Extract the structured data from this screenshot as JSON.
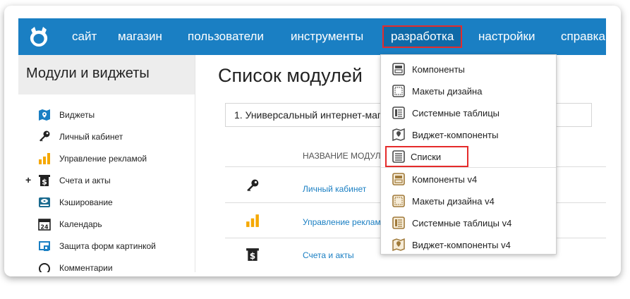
{
  "nav": {
    "items": [
      {
        "label": "сайт"
      },
      {
        "label": "магазин"
      },
      {
        "label": "пользователи"
      },
      {
        "label": "инструменты"
      },
      {
        "label": "разработка"
      },
      {
        "label": "настройки"
      },
      {
        "label": "справка"
      }
    ]
  },
  "sidebar": {
    "title": "Модули и виджеты",
    "items": [
      {
        "label": "Виджеты",
        "icon": "widget-map-icon"
      },
      {
        "label": "Личный кабинет",
        "icon": "key-icon"
      },
      {
        "label": "Управление рекламой",
        "icon": "bar-chart-icon"
      },
      {
        "label": "Счета и акты",
        "icon": "dollar-receipt-icon",
        "expand": "+"
      },
      {
        "label": "Кэширование",
        "icon": "disk-icon"
      },
      {
        "label": "Календарь",
        "icon": "calendar-icon",
        "calendar_day": "24"
      },
      {
        "label": "Защита форм картинкой",
        "icon": "captcha-icon"
      },
      {
        "label": "Комментарии",
        "icon": "comment-icon"
      }
    ]
  },
  "main": {
    "title": "Список модулей",
    "site_select": "1. Универсальный интернет-магазин",
    "column_header": "НАЗВАНИЕ МОДУЛЯ",
    "rows": [
      {
        "label": "Личный кабинет",
        "icon": "key-icon"
      },
      {
        "label": "Управление рекламой",
        "icon": "bar-chart-icon"
      },
      {
        "label": "Счета и акты",
        "icon": "dollar-receipt-icon"
      }
    ]
  },
  "dropdown": {
    "items": [
      {
        "label": "Компоненты",
        "icon": "component-icon",
        "color": "#4a4a4a"
      },
      {
        "label": "Макеты дизайна",
        "icon": "layout-icon",
        "color": "#4a4a4a"
      },
      {
        "label": "Системные таблицы",
        "icon": "table-icon",
        "color": "#4a4a4a"
      },
      {
        "label": "Виджет-компоненты",
        "icon": "widget-component-icon",
        "color": "#4a4a4a"
      },
      {
        "label": "Списки",
        "icon": "list-icon",
        "color": "#4a4a4a"
      },
      {
        "label": "Компоненты v4",
        "icon": "component-v4-icon",
        "color": "#a07a3a"
      },
      {
        "label": "Макеты дизайна v4",
        "icon": "layout-v4-icon",
        "color": "#a07a3a"
      },
      {
        "label": "Системные таблицы v4",
        "icon": "table-v4-icon",
        "color": "#a07a3a"
      },
      {
        "label": "Виджет-компоненты v4",
        "icon": "widget-component-v4-icon",
        "color": "#a07a3a"
      }
    ]
  },
  "colors": {
    "nav_bg": "#1a7fc3",
    "highlight": "#e52b2b",
    "link": "#1a7fc3",
    "accent_yellow": "#f5a800"
  }
}
